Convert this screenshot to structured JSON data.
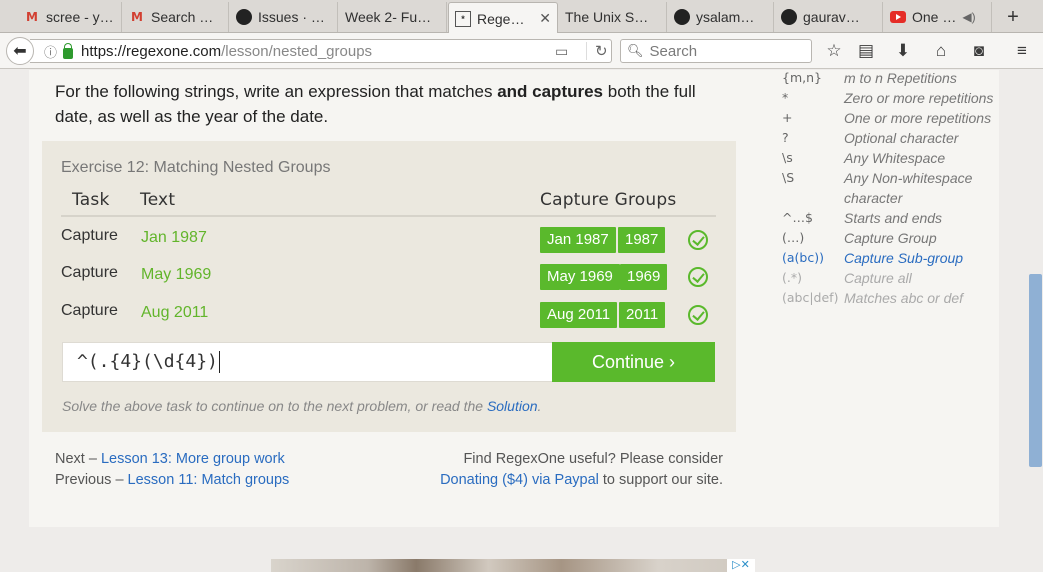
{
  "browser": {
    "tabs": [
      {
        "label": "scree - y…",
        "icon": "gmail-icon"
      },
      {
        "label": "Search …",
        "icon": "gmail-icon"
      },
      {
        "label": "Issues · …",
        "icon": "github-icon"
      },
      {
        "label": "Week 2- Fu…",
        "icon": "none"
      },
      {
        "label": "Rege…",
        "icon": "regexone-icon",
        "active": true
      },
      {
        "label": "The Unix S…",
        "icon": "none"
      },
      {
        "label": "ysalam…",
        "icon": "github-icon"
      },
      {
        "label": "gaurav…",
        "icon": "github-icon"
      },
      {
        "label": "One …",
        "icon": "youtube-icon"
      }
    ],
    "new_tab": "+",
    "url_host": "https://regexone.com",
    "url_path": "/lesson/nested_groups",
    "search_placeholder": "Search"
  },
  "lesson": {
    "intro_pre": "For the following strings, write an expression that matches ",
    "intro_bold": "and captures",
    "intro_post": " both the full date, as well as the year of the date.",
    "exercise_title": "Exercise 12: Matching Nested Groups",
    "headers": {
      "task": "Task",
      "text": "Text",
      "capture_groups": "Capture Groups"
    },
    "rows": [
      {
        "task": "Capture",
        "text": "Jan 1987",
        "groups": [
          "Jan 1987",
          "1987"
        ]
      },
      {
        "task": "Capture",
        "text": "May 1969",
        "groups": [
          "May 1969",
          "1969"
        ]
      },
      {
        "task": "Capture",
        "text": "Aug 2011",
        "groups": [
          "Aug 2011",
          "2011"
        ]
      }
    ],
    "input_value": "^(.{4}(\\d{4})",
    "continue_label": "Continue ›",
    "hint_pre": "Solve the above task to continue on to the next problem, or read the ",
    "hint_link": "Solution",
    "hint_post": ".",
    "next_prefix": "Next – ",
    "next_link": "Lesson 13: More group work",
    "prev_prefix": "Previous – ",
    "prev_link": "Lesson 11: Match groups",
    "support_line1": "Find RegexOne useful? Please consider",
    "support_link": "Donating ($4) via Paypal",
    "support_post": " to support our site."
  },
  "cheatsheet": [
    {
      "sym": "{m,n}",
      "desc": "m to n Repetitions"
    },
    {
      "sym": "*",
      "desc": "Zero or more repetitions"
    },
    {
      "sym": "+",
      "desc": "One or more repetitions"
    },
    {
      "sym": "?",
      "desc": "Optional character"
    },
    {
      "sym": "\\s",
      "desc": "Any Whitespace"
    },
    {
      "sym": "\\S",
      "desc": "Any Non-whitespace character"
    },
    {
      "sym": "^…$",
      "desc": "Starts and ends"
    },
    {
      "sym": "(…)",
      "desc": "Capture Group"
    },
    {
      "sym": "(a(bc))",
      "desc": "Capture Sub-group"
    },
    {
      "sym": "(.*)",
      "desc": "Capture all"
    },
    {
      "sym": "(abc|def)",
      "desc": "Matches abc or def"
    }
  ],
  "colors": {
    "accent_green": "#5ab92c",
    "link_blue": "#2a6cc0"
  }
}
